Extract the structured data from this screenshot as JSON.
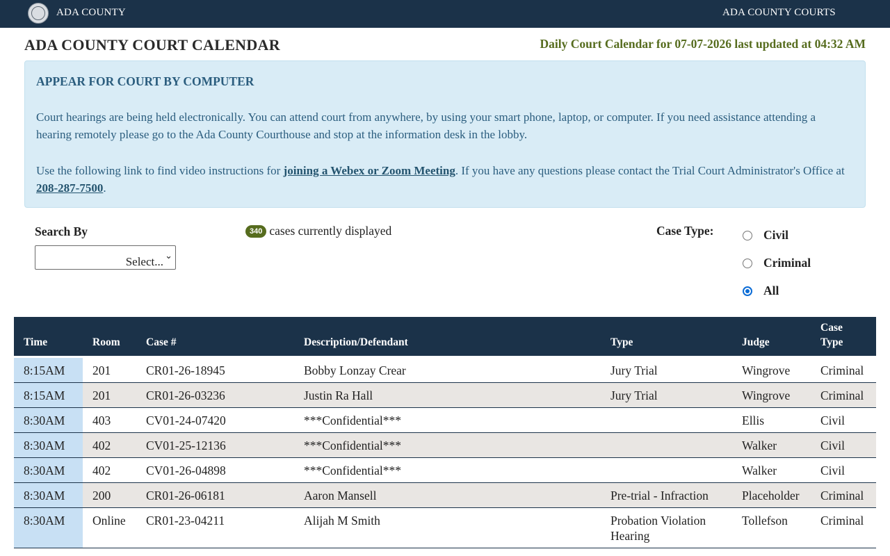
{
  "header": {
    "brand_left": "ADA COUNTY",
    "brand_right": "ADA COUNTY COURTS",
    "seal_icon": "county-seal-icon"
  },
  "page": {
    "title": "ADA COUNTY COURT CALENDAR",
    "updated": "Daily Court Calendar for 07-07-2026 last updated at 04:32 AM"
  },
  "notice": {
    "title": "APPEAR FOR COURT BY COMPUTER",
    "para1": "Court hearings are being held electronically. You can attend court from anywhere, by using your smart phone, laptop, or computer.  If you need assistance attending a hearing remotely please go to the Ada County Courthouse and stop at the information desk in the lobby.",
    "para2_before": "Use the following link to find video instructions for ",
    "para2_link": "joining a Webex or Zoom Meeting",
    "para2_middle": ". If you have any questions please contact the Trial Court Administrator's Office at ",
    "para2_phone": "208-287-7500",
    "para2_after": "."
  },
  "search": {
    "label": "Search By",
    "select_value": "Select..."
  },
  "count": {
    "value": "340",
    "label": "cases currently displayed"
  },
  "case_type": {
    "label": "Case Type:",
    "options": [
      "Civil",
      "Criminal",
      "All"
    ],
    "selected": "All"
  },
  "table": {
    "headers": {
      "time": "Time",
      "room": "Room",
      "case": "Case #",
      "desc": "Description/Defendant",
      "type": "Type",
      "judge": "Judge",
      "case_type_line1": "Case",
      "case_type_line2": "Type"
    },
    "rows": [
      {
        "time": "8:15AM",
        "room": "201",
        "case": "CR01-26-18945",
        "desc": "Bobby Lonzay Crear",
        "type": "Jury Trial",
        "judge": "Wingrove",
        "ctype": "Criminal"
      },
      {
        "time": "8:15AM",
        "room": "201",
        "case": "CR01-26-03236",
        "desc": "Justin Ra Hall",
        "type": "Jury Trial",
        "judge": "Wingrove",
        "ctype": "Criminal"
      },
      {
        "time": "8:30AM",
        "room": "403",
        "case": "CV01-24-07420",
        "desc": "***Confidential***",
        "type": "",
        "judge": "Ellis",
        "ctype": "Civil"
      },
      {
        "time": "8:30AM",
        "room": "402",
        "case": "CV01-25-12136",
        "desc": "***Confidential***",
        "type": "",
        "judge": "Walker",
        "ctype": "Civil"
      },
      {
        "time": "8:30AM",
        "room": "402",
        "case": "CV01-26-04898",
        "desc": "***Confidential***",
        "type": "",
        "judge": "Walker",
        "ctype": "Civil"
      },
      {
        "time": "8:30AM",
        "room": "200",
        "case": "CR01-26-06181",
        "desc": "Aaron Mansell",
        "type": "Pre-trial - Infraction",
        "judge": "Placeholder",
        "ctype": "Criminal"
      },
      {
        "time": "8:30AM",
        "room": "Online",
        "case": "CR01-23-04211",
        "desc": "Alijah M Smith",
        "type": "Probation Violation Hearing",
        "judge": "Tollefson",
        "ctype": "Criminal"
      }
    ]
  }
}
